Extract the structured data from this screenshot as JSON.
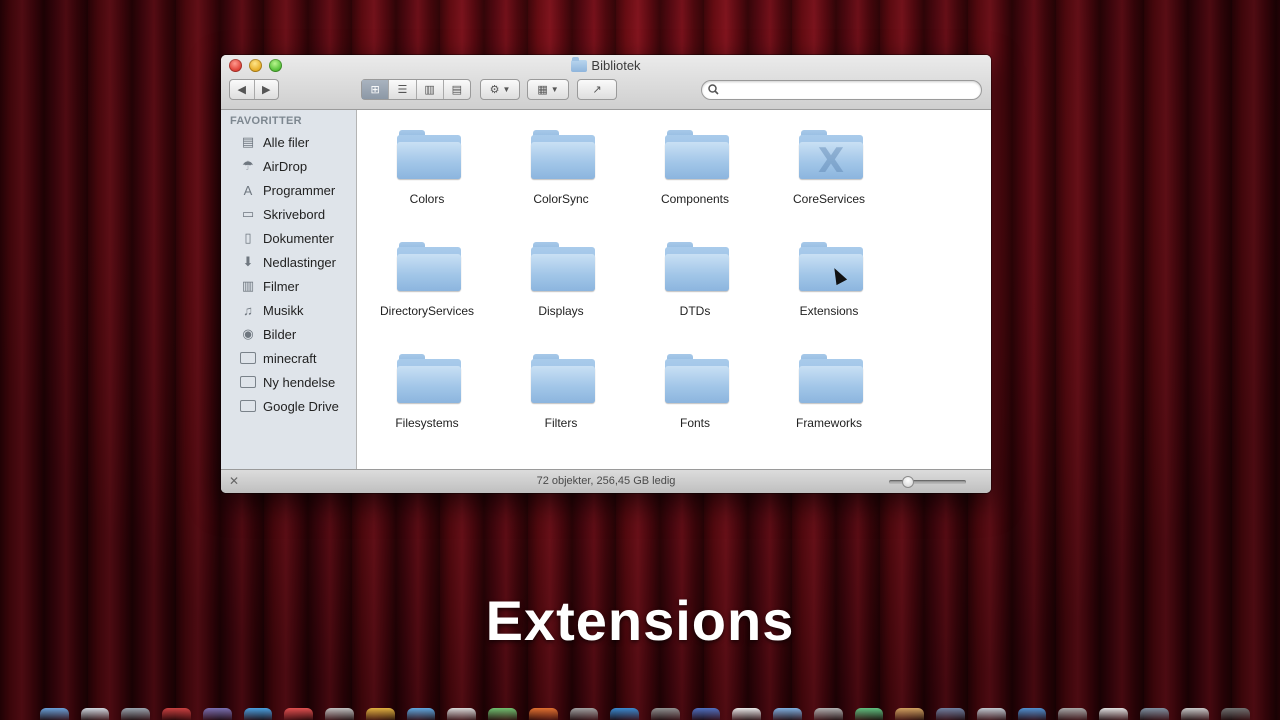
{
  "window": {
    "title": "Bibliotek",
    "search_placeholder": "",
    "nav": {
      "back": "◀",
      "forward": "▶"
    },
    "view_buttons": [
      "⊞",
      "☰",
      "▥",
      "▤"
    ],
    "action_icon": "⚙",
    "arrange_icon": "▦",
    "share_icon": "↗",
    "caret": "▼"
  },
  "sidebar": {
    "header": "FAVORITTER",
    "items": [
      {
        "label": "Alle filer",
        "icon": "▤"
      },
      {
        "label": "AirDrop",
        "icon": "☂"
      },
      {
        "label": "Programmer",
        "icon": "A"
      },
      {
        "label": "Skrivebord",
        "icon": "▭"
      },
      {
        "label": "Dokumenter",
        "icon": "▯"
      },
      {
        "label": "Nedlastinger",
        "icon": "⬇"
      },
      {
        "label": "Filmer",
        "icon": "▥"
      },
      {
        "label": "Musikk",
        "icon": "♫"
      },
      {
        "label": "Bilder",
        "icon": "◉"
      },
      {
        "label": "minecraft",
        "icon": "folder"
      },
      {
        "label": "Ny hendelse",
        "icon": "folder"
      },
      {
        "label": "Google Drive",
        "icon": "folder"
      }
    ]
  },
  "content": {
    "folders": [
      {
        "label": "Colors",
        "emblem": ""
      },
      {
        "label": "ColorSync",
        "emblem": ""
      },
      {
        "label": "Components",
        "emblem": ""
      },
      {
        "label": "CoreServices",
        "emblem": "X"
      },
      {
        "label": "DirectoryServices",
        "emblem": ""
      },
      {
        "label": "Displays",
        "emblem": ""
      },
      {
        "label": "DTDs",
        "emblem": ""
      },
      {
        "label": "Extensions",
        "emblem": ""
      },
      {
        "label": "Filesystems",
        "emblem": ""
      },
      {
        "label": "Filters",
        "emblem": ""
      },
      {
        "label": "Fonts",
        "emblem": ""
      },
      {
        "label": "Frameworks",
        "emblem": ""
      }
    ]
  },
  "statusbar": {
    "text": "72 objekter, 256,45 GB ledig",
    "icon_size_fraction": 0.25
  },
  "caption": "Extensions",
  "colors": {
    "curtain": "#6a0a12",
    "sidebar_bg": "#dfe4ea",
    "folder_blue": "#a2c6e8",
    "active_segment": "#8c98a6"
  }
}
